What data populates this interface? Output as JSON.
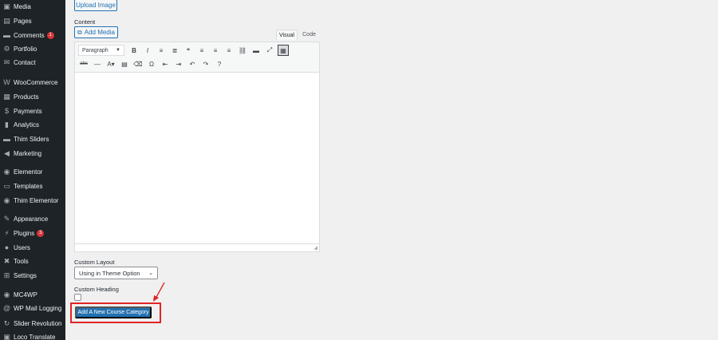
{
  "sidebar": {
    "items": [
      {
        "label": "Media",
        "icon": "media-icon",
        "glyph": "▣"
      },
      {
        "label": "Pages",
        "icon": "pages-icon",
        "glyph": "▤"
      },
      {
        "label": "Comments",
        "icon": "comments-icon",
        "glyph": "▬",
        "badge": "1"
      },
      {
        "label": "Portfolio",
        "icon": "portfolio-icon",
        "glyph": "⚙"
      },
      {
        "label": "Contact",
        "icon": "contact-icon",
        "glyph": "✉"
      },
      {
        "label": "WooCommerce",
        "icon": "woocommerce-icon",
        "glyph": "W"
      },
      {
        "label": "Products",
        "icon": "products-icon",
        "glyph": "▦"
      },
      {
        "label": "Payments",
        "icon": "payments-icon",
        "glyph": "$"
      },
      {
        "label": "Analytics",
        "icon": "analytics-icon",
        "glyph": "▮"
      },
      {
        "label": "Thim Sliders",
        "icon": "sliders-icon",
        "glyph": "▬"
      },
      {
        "label": "Marketing",
        "icon": "marketing-icon",
        "glyph": "◀"
      },
      {
        "label": "Elementor",
        "icon": "elementor-icon",
        "glyph": "◉"
      },
      {
        "label": "Templates",
        "icon": "templates-icon",
        "glyph": "▭"
      },
      {
        "label": "Thim Elementor",
        "icon": "thim-elementor-icon",
        "glyph": "◉"
      },
      {
        "label": "Appearance",
        "icon": "appearance-icon",
        "glyph": "✎"
      },
      {
        "label": "Plugins",
        "icon": "plugins-icon",
        "glyph": "⚡",
        "badge": "3"
      },
      {
        "label": "Users",
        "icon": "users-icon",
        "glyph": "●"
      },
      {
        "label": "Tools",
        "icon": "tools-icon",
        "glyph": "✖"
      },
      {
        "label": "Settings",
        "icon": "settings-icon",
        "glyph": "⊞"
      },
      {
        "label": "MC4WP",
        "icon": "mc4wp-icon",
        "glyph": "◉"
      },
      {
        "label": "WP Mail Logging",
        "icon": "mail-logging-icon",
        "glyph": "@"
      },
      {
        "label": "Slider Revolution",
        "icon": "slider-revolution-icon",
        "glyph": "↻"
      },
      {
        "label": "Loco Translate",
        "icon": "loco-translate-icon",
        "glyph": "▣"
      }
    ]
  },
  "form": {
    "upload_image_label": "Upload Image",
    "content_label": "Content",
    "add_media_label": "Add Media",
    "tab_visual": "Visual",
    "tab_code": "Code",
    "format_select_value": "Paragraph",
    "custom_layout_label": "Custom Layout",
    "custom_layout_value": "Using in Theme Option",
    "custom_heading_label": "Custom Heading",
    "submit_label": "Add A New Course Category"
  },
  "toolbar": {
    "row1": [
      {
        "name": "bold-icon",
        "glyph": "B"
      },
      {
        "name": "italic-icon",
        "glyph": "I"
      },
      {
        "name": "bulleted-list-icon",
        "glyph": "≡"
      },
      {
        "name": "numbered-list-icon",
        "glyph": "≣"
      },
      {
        "name": "blockquote-icon",
        "glyph": "❝"
      },
      {
        "name": "align-left-icon",
        "glyph": "≡"
      },
      {
        "name": "align-center-icon",
        "glyph": "≡"
      },
      {
        "name": "align-right-icon",
        "glyph": "≡"
      },
      {
        "name": "link-icon",
        "glyph": "⛓"
      },
      {
        "name": "read-more-icon",
        "glyph": "▬"
      },
      {
        "name": "fullscreen-icon",
        "glyph": "⤢"
      },
      {
        "name": "toolbar-toggle-icon",
        "glyph": "▦"
      }
    ],
    "row2": [
      {
        "name": "strikethrough-icon",
        "glyph": "abc"
      },
      {
        "name": "horizontal-line-icon",
        "glyph": "—"
      },
      {
        "name": "text-color-icon",
        "glyph": "A▾"
      },
      {
        "name": "paste-text-icon",
        "glyph": "▤"
      },
      {
        "name": "clear-formatting-icon",
        "glyph": "⌫"
      },
      {
        "name": "special-character-icon",
        "glyph": "Ω"
      },
      {
        "name": "outdent-icon",
        "glyph": "⇤"
      },
      {
        "name": "indent-icon",
        "glyph": "⇥"
      },
      {
        "name": "undo-icon",
        "glyph": "↶"
      },
      {
        "name": "redo-icon",
        "glyph": "↷"
      },
      {
        "name": "help-icon",
        "glyph": "?"
      }
    ]
  },
  "colors": {
    "primary": "#2271b1",
    "highlight": "#e02424",
    "sidebar": "#1d2327"
  }
}
